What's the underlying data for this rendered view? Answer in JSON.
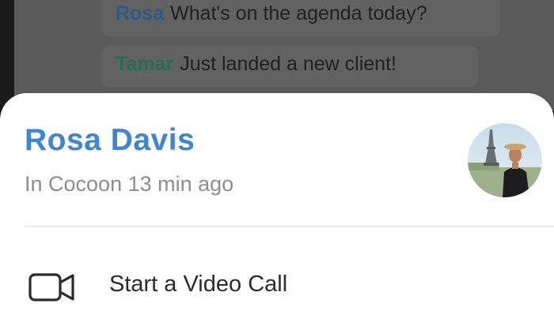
{
  "chat": {
    "messages": [
      {
        "sender": "Rosa",
        "text": "What's on the agenda today?",
        "sender_color": "#2c5a86"
      },
      {
        "sender": "Tamar",
        "text": "Just landed a new client!",
        "sender_color": "#276c56"
      }
    ]
  },
  "profile": {
    "name": "Rosa Davis",
    "status": "In Cocoon 13 min ago",
    "name_color": "#3e86cf"
  },
  "actions": [
    {
      "label": "Start a Video Call",
      "icon": "video-camera-icon"
    }
  ]
}
